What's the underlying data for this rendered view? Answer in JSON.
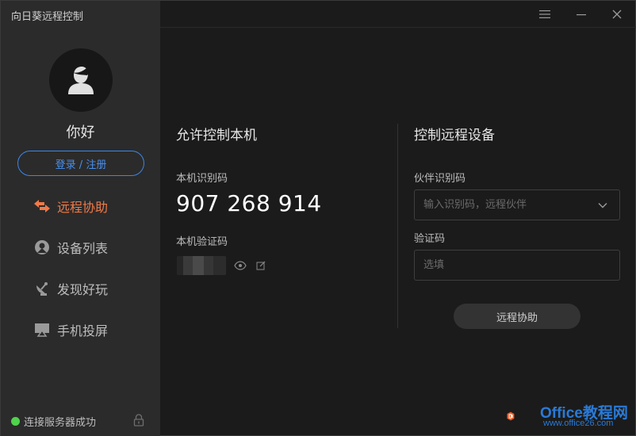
{
  "app": {
    "title": "向日葵远程控制"
  },
  "user": {
    "greeting": "你好",
    "login_label": "登录 / 注册"
  },
  "nav": [
    {
      "label": "远程协助",
      "icon": "swap-arrows-icon",
      "active": true
    },
    {
      "label": "设备列表",
      "icon": "device-pin-icon",
      "active": false
    },
    {
      "label": "发现好玩",
      "icon": "satellite-icon",
      "active": false
    },
    {
      "label": "手机投屏",
      "icon": "screen-cast-icon",
      "active": false
    }
  ],
  "status": {
    "text": "连接服务器成功",
    "color": "#4ed34b"
  },
  "allow": {
    "title": "允许控制本机",
    "id_label": "本机识别码",
    "id_value": "907 268 914",
    "verify_label": "本机验证码"
  },
  "control": {
    "title": "控制远程设备",
    "partner_label": "伙伴识别码",
    "partner_placeholder": "输入识别码，远程伙伴",
    "code_label": "验证码",
    "code_placeholder": "选填",
    "connect_label": "远程协助"
  },
  "colors": {
    "accent": "#f07a48",
    "link": "#4a90ee",
    "sidebar": "#2b2b2b",
    "main": "#1b1b1b"
  },
  "watermark": {
    "brand": "Office教程网",
    "url": "www.office26.com"
  }
}
